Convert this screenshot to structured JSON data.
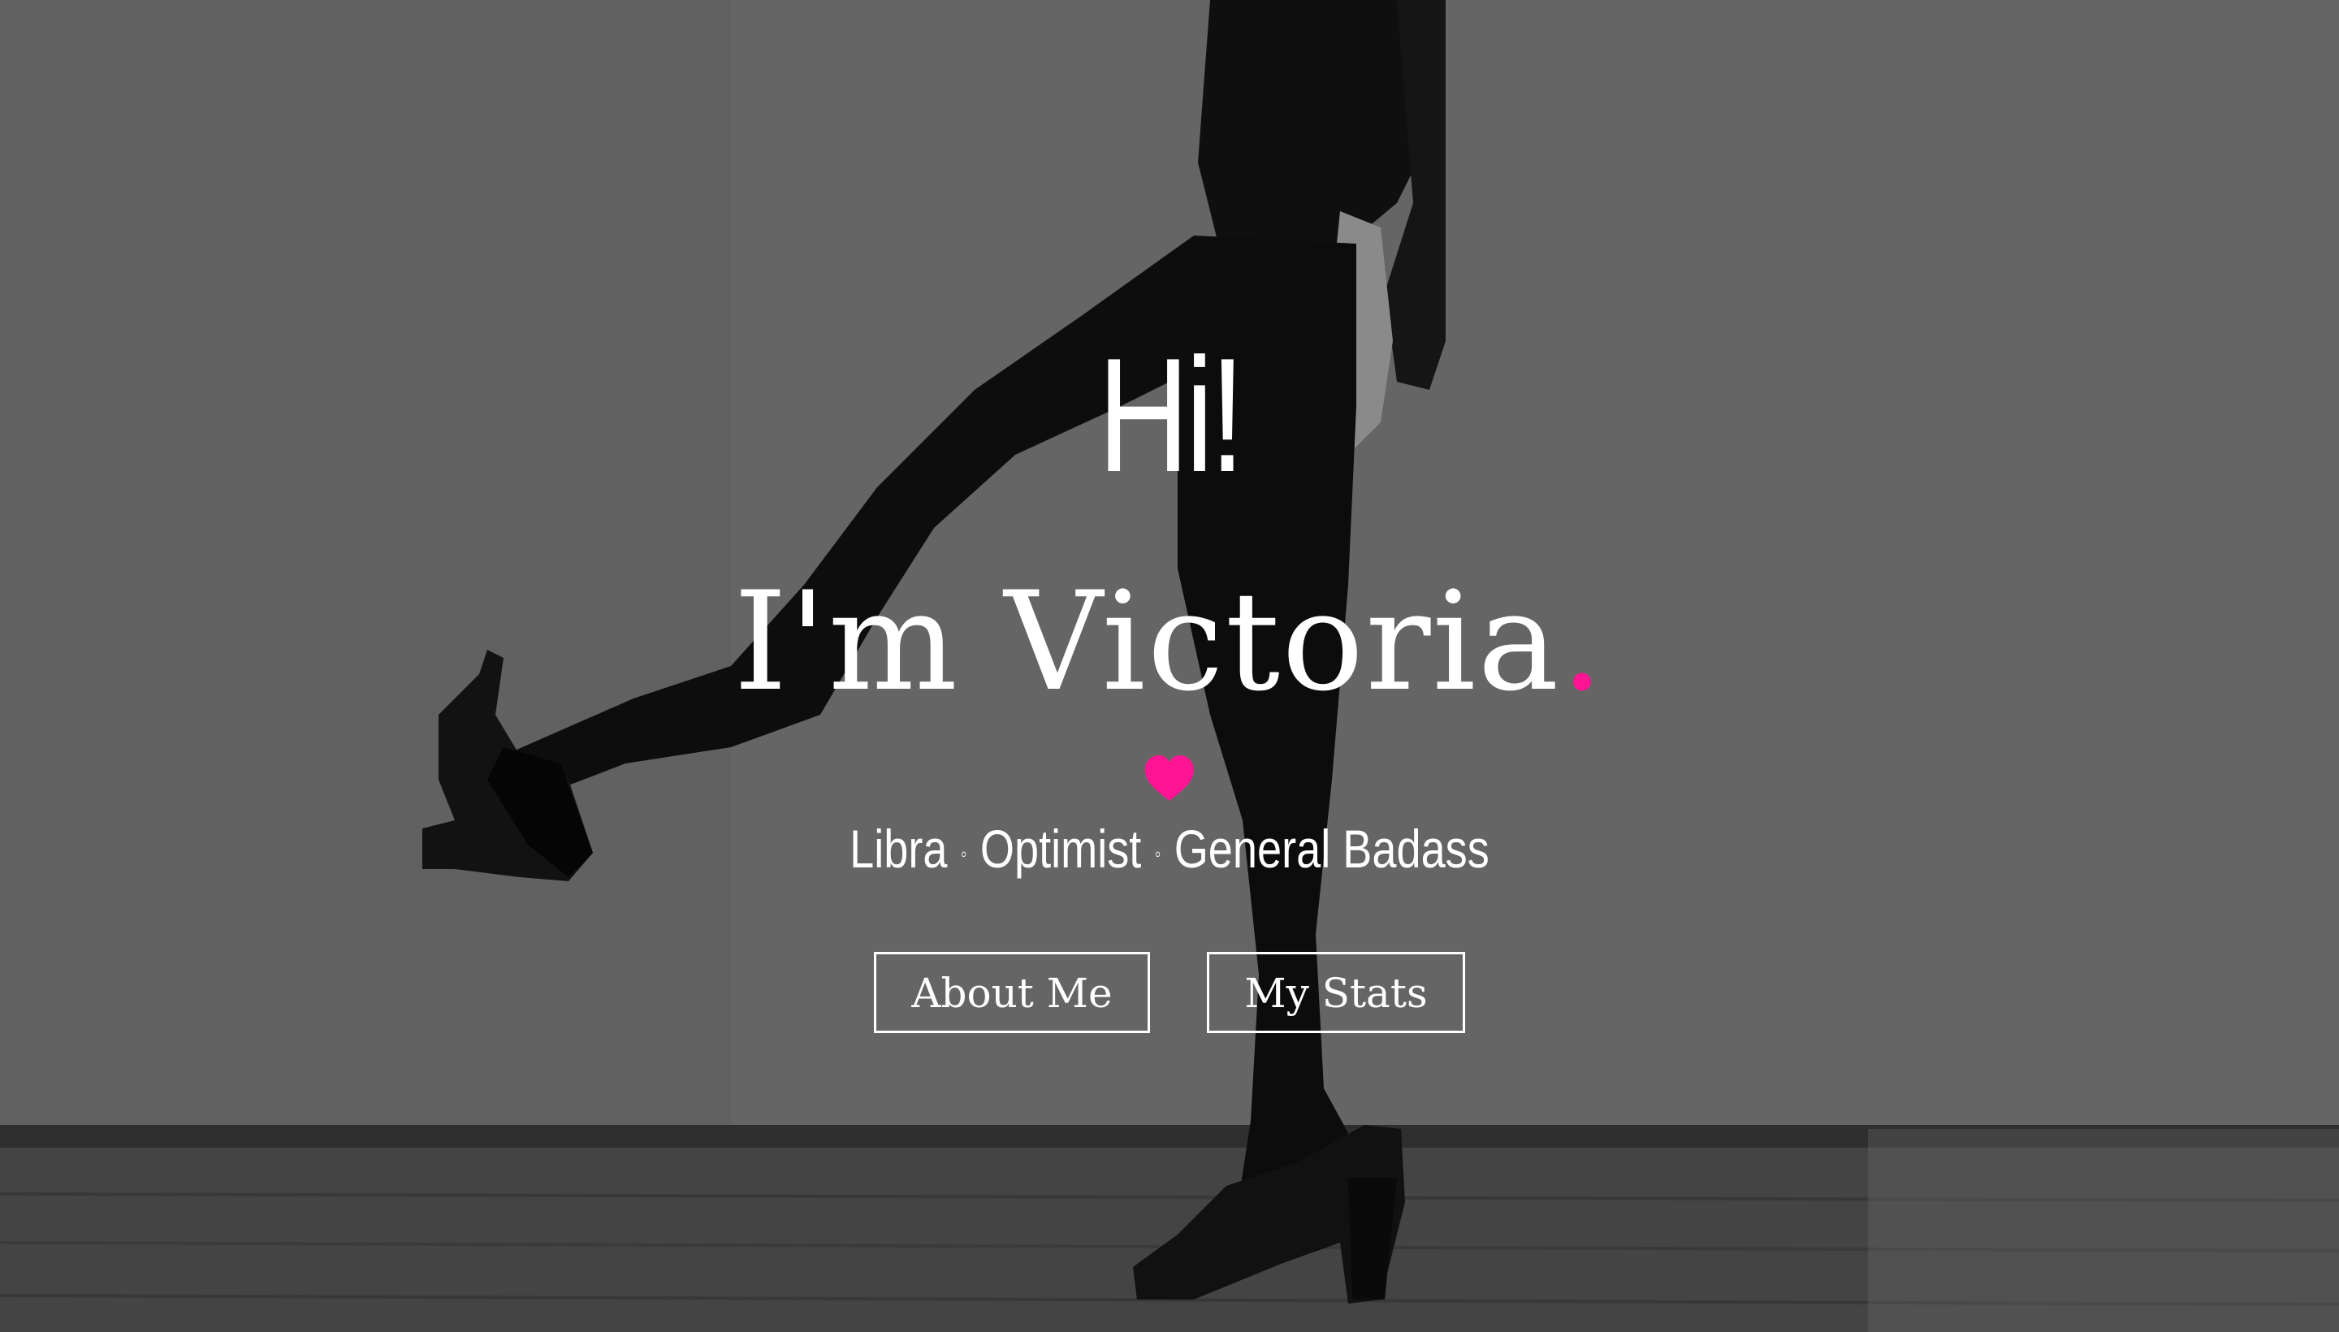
{
  "hero": {
    "greeting": "Hi!",
    "name_prefix": "I'm Victoria",
    "name_dot": ".",
    "traits": [
      "Libra",
      "Optimist",
      "General Badass"
    ],
    "trait_separator": "◦",
    "heart_icon": "heart-icon",
    "accent_color": "#ff1493"
  },
  "buttons": {
    "about_label": "About Me",
    "stats_label": "My Stats"
  }
}
